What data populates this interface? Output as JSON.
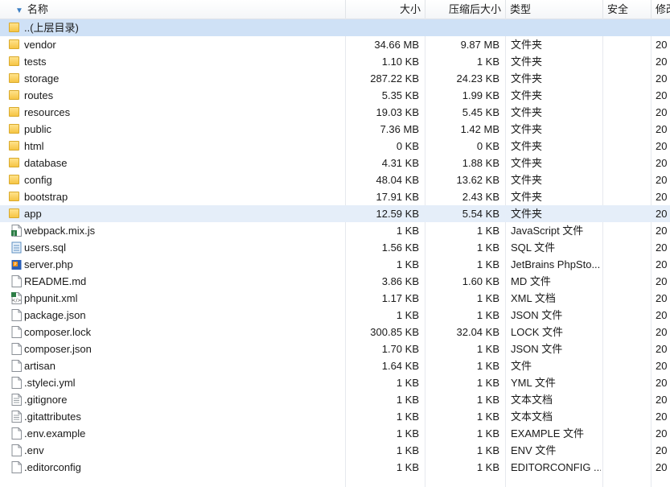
{
  "columns": {
    "name": "名称",
    "size": "大小",
    "compressed": "压缩后大小",
    "type": "类型",
    "security": "安全",
    "modified": "修改"
  },
  "parent_label": "..(上层目录)",
  "rows": [
    {
      "name": "vendor",
      "size": "34.66 MB",
      "compressed": "9.87 MB",
      "type": "文件夹",
      "date": "20",
      "icon": "folder-icon"
    },
    {
      "name": "tests",
      "size": "1.10 KB",
      "compressed": "1 KB",
      "type": "文件夹",
      "date": "20",
      "icon": "folder-icon"
    },
    {
      "name": "storage",
      "size": "287.22 KB",
      "compressed": "24.23 KB",
      "type": "文件夹",
      "date": "20",
      "icon": "folder-icon"
    },
    {
      "name": "routes",
      "size": "5.35 KB",
      "compressed": "1.99 KB",
      "type": "文件夹",
      "date": "20",
      "icon": "folder-icon"
    },
    {
      "name": "resources",
      "size": "19.03 KB",
      "compressed": "5.45 KB",
      "type": "文件夹",
      "date": "20",
      "icon": "folder-icon"
    },
    {
      "name": "public",
      "size": "7.36 MB",
      "compressed": "1.42 MB",
      "type": "文件夹",
      "date": "20",
      "icon": "folder-icon"
    },
    {
      "name": "html",
      "size": "0 KB",
      "compressed": "0 KB",
      "type": "文件夹",
      "date": "20",
      "icon": "folder-icon"
    },
    {
      "name": "database",
      "size": "4.31 KB",
      "compressed": "1.88 KB",
      "type": "文件夹",
      "date": "20",
      "icon": "folder-icon"
    },
    {
      "name": "config",
      "size": "48.04 KB",
      "compressed": "13.62 KB",
      "type": "文件夹",
      "date": "20",
      "icon": "folder-icon"
    },
    {
      "name": "bootstrap",
      "size": "17.91 KB",
      "compressed": "2.43 KB",
      "type": "文件夹",
      "date": "20",
      "icon": "folder-icon"
    },
    {
      "name": "app",
      "size": "12.59 KB",
      "compressed": "5.54 KB",
      "type": "文件夹",
      "date": "20",
      "icon": "folder-icon",
      "selected": true
    },
    {
      "name": "webpack.mix.js",
      "size": "1 KB",
      "compressed": "1 KB",
      "type": "JavaScript 文件",
      "date": "20",
      "icon": "js-file-icon"
    },
    {
      "name": "users.sql",
      "size": "1.56 KB",
      "compressed": "1 KB",
      "type": "SQL 文件",
      "date": "20",
      "icon": "sql-file-icon"
    },
    {
      "name": "server.php",
      "size": "1 KB",
      "compressed": "1 KB",
      "type": "JetBrains PhpSto...",
      "date": "20",
      "icon": "php-file-icon"
    },
    {
      "name": "README.md",
      "size": "3.86 KB",
      "compressed": "1.60 KB",
      "type": "MD 文件",
      "date": "20",
      "icon": "file-icon"
    },
    {
      "name": "phpunit.xml",
      "size": "1.17 KB",
      "compressed": "1 KB",
      "type": "XML 文档",
      "date": "20",
      "icon": "xml-file-icon"
    },
    {
      "name": "package.json",
      "size": "1 KB",
      "compressed": "1 KB",
      "type": "JSON 文件",
      "date": "20",
      "icon": "file-icon"
    },
    {
      "name": "composer.lock",
      "size": "300.85 KB",
      "compressed": "32.04 KB",
      "type": "LOCK 文件",
      "date": "20",
      "icon": "file-icon"
    },
    {
      "name": "composer.json",
      "size": "1.70 KB",
      "compressed": "1 KB",
      "type": "JSON 文件",
      "date": "20",
      "icon": "file-icon"
    },
    {
      "name": "artisan",
      "size": "1.64 KB",
      "compressed": "1 KB",
      "type": "文件",
      "date": "20",
      "icon": "file-icon"
    },
    {
      "name": ".styleci.yml",
      "size": "1 KB",
      "compressed": "1 KB",
      "type": "YML 文件",
      "date": "20",
      "icon": "file-icon"
    },
    {
      "name": ".gitignore",
      "size": "1 KB",
      "compressed": "1 KB",
      "type": "文本文档",
      "date": "20",
      "icon": "text-file-icon"
    },
    {
      "name": ".gitattributes",
      "size": "1 KB",
      "compressed": "1 KB",
      "type": "文本文档",
      "date": "20",
      "icon": "text-file-icon"
    },
    {
      "name": ".env.example",
      "size": "1 KB",
      "compressed": "1 KB",
      "type": "EXAMPLE 文件",
      "date": "20",
      "icon": "file-icon"
    },
    {
      "name": ".env",
      "size": "1 KB",
      "compressed": "1 KB",
      "type": "ENV 文件",
      "date": "20",
      "icon": "file-icon"
    },
    {
      "name": ".editorconfig",
      "size": "1 KB",
      "compressed": "1 KB",
      "type": "EDITORCONFIG ...",
      "date": "20",
      "icon": "file-icon"
    }
  ],
  "colors": {
    "selected_row": "#e5eef9",
    "parent_row": "#cfe1f6",
    "folder": "#f6c544",
    "sort_arrow": "#3c7fc4"
  }
}
